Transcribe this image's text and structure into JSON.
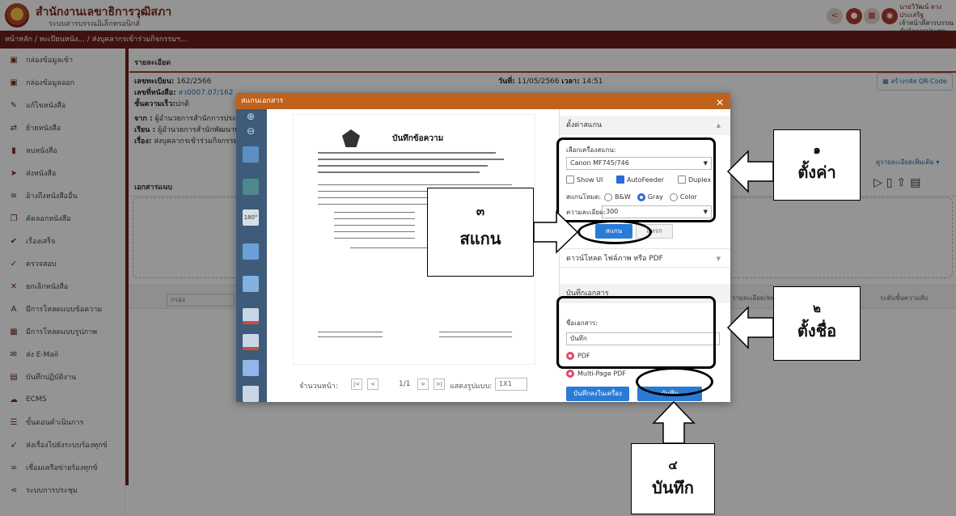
{
  "header": {
    "org_name": "สำนักงานเลขาธิการวุฒิสภา",
    "org_sub": "ระบบสารบรรณอิเล็กทรอนิกส์",
    "user_name": "นายวิวัฒน์ ดวงประเสริฐ",
    "user_role": "เจ้าหน้าที่สารบรรณ",
    "user_unit": "สำนักการประชุม"
  },
  "breadcrumb": "หน้าหลัก / ทะเบียนหนัง... / ส่งบุคลากรเข้าร่วมกิจกรรมฯ...",
  "sidebar": {
    "items": [
      {
        "label": "กล่องข้อมูลเข้า",
        "icon": "inbox-icon",
        "glyph": "▣"
      },
      {
        "label": "กล่องข้อมูลออก",
        "icon": "outbox-icon",
        "glyph": "▣"
      },
      {
        "label": "แก้ไขหนังสือ",
        "icon": "edit-icon",
        "glyph": "✎"
      },
      {
        "label": "ย้ายหนังสือ",
        "icon": "move-icon",
        "glyph": "⇄"
      },
      {
        "label": "ลบหนังสือ",
        "icon": "trash-icon",
        "glyph": "▮"
      },
      {
        "label": "ส่งหนังสือ",
        "icon": "send-icon",
        "glyph": "➤"
      },
      {
        "label": "อ้างถึงหนังสืออื่น",
        "icon": "reference-icon",
        "glyph": "≡"
      },
      {
        "label": "คัดลอกหนังสือ",
        "icon": "copy-icon",
        "glyph": "❐"
      },
      {
        "label": "เรื่องเสร็จ",
        "icon": "done-icon",
        "glyph": "✔"
      },
      {
        "label": "ตรวจสอบ",
        "icon": "check-icon",
        "glyph": "✓"
      },
      {
        "label": "ยกเลิกหนังสือ",
        "icon": "cancel-icon",
        "glyph": "✕"
      },
      {
        "label": "มีการโหลดแบบข้อความ",
        "icon": "text-icon",
        "glyph": "A"
      },
      {
        "label": "มีการโหลดแบบรูปภาพ",
        "icon": "image-icon",
        "glyph": "▦"
      },
      {
        "label": "ส่ง E-Mail",
        "icon": "mail-icon",
        "glyph": "✉"
      },
      {
        "label": "บันทึกปฏิบัติงาน",
        "icon": "log-icon",
        "glyph": "▤"
      },
      {
        "label": "ECMS",
        "icon": "cloud-icon",
        "glyph": "☁"
      },
      {
        "label": "ขั้นตอนดำเนินการ",
        "icon": "steps-icon",
        "glyph": "☰"
      },
      {
        "label": "ส่งเรื่องไปยังระบบร้องทุกข์",
        "icon": "forward-icon",
        "glyph": "➶"
      },
      {
        "label": "เชื่อมเครือข่ายร้องทุกข์",
        "icon": "link-icon",
        "glyph": "∞"
      },
      {
        "label": "ระบบการประชุม",
        "icon": "share-icon",
        "glyph": "⋖"
      }
    ]
  },
  "main": {
    "section_detail": "รายละเอียด",
    "reg_label": "เลขทะเบียน:",
    "reg_value": "162/2566",
    "doc_no_label": "เลขที่หนังสือ:",
    "doc_no_value": "สว0007.07/162",
    "priority_label": "ชั้นความเร็ว:",
    "priority_value": "ปกติ",
    "from_label": "จาก :",
    "from_value": "ผู้อำนวยการสำนักการประชุ",
    "to_label": "เรียน :",
    "to_value": "ผู้อำนวยการสำนักพัฒนาทรั",
    "subject_label": "เรื่อง:",
    "subject_value": "ส่งบุคลากรเข้าร่วมกิจกรรมฯ",
    "date_label": "วันที่:",
    "date_value": "11/05/2566",
    "time_label": "เวลา:",
    "time_value": "14:51",
    "qr_button": "สร้างรหัส QR-Code",
    "more_details": "ดูรายละเอียดเพิ่มเติม ▾",
    "attachments": "เอกสารแนบ",
    "col_detail": "รายละเอียด/หมายเหตุ",
    "col_secret": "ระดับชั้นความลับ",
    "filter_placeholder": "กรอง"
  },
  "modal": {
    "title": "สแกนเอกสาร",
    "close": "✕",
    "preview_doc_title": "บันทึกข้อความ",
    "pager_label": "จำนวนหน้า:",
    "page_first": "|<",
    "page_prev": "<",
    "page_num": "1/1",
    "page_next": ">",
    "page_last": ">|",
    "view_label": "แสดงรูปแบบ:",
    "view_value": "1X1",
    "settings_header": "ตั้งค่าสแกน",
    "scanner_label": "เลือกเครื่องสแกน:",
    "scanner_value": "Canon MF745/746",
    "show_ui": "Show UI",
    "auto_feeder": "AutoFeeder",
    "duplex": "Duplex",
    "mode_label": "สแกนโหมด:",
    "mode_bw": "B&W",
    "mode_gray": "Gray",
    "mode_color": "Color",
    "resolution_label": "ความละเอียด:",
    "resolution_value": "300",
    "scan_button": "สแกน",
    "insert_button": "แทรก",
    "download_header": "ดาวน์โหลด ไฟล์ภาพ หรือ PDF",
    "save_header": "บันทึกเอกสาร",
    "docname_label": "ชื่อเอกสาร:",
    "docname_value": "บันทึก",
    "pdf": "PDF",
    "multi_pdf": "Multi-Page PDF",
    "save_local": "บันทึกลงในเครื่อง",
    "save": "บันทึก"
  },
  "annotations": {
    "a1_num": "๑",
    "a1_word": "ตั้งค่า",
    "a2_num": "๒",
    "a2_word": "ตั้งชื่อ",
    "a3_num": "๓",
    "a3_word": "สแกน",
    "a4_num": "๔",
    "a4_word": "บันทึก"
  },
  "colors": {
    "brand_dark": "#6e1f1a",
    "modal_header": "#c0621c",
    "primary_button": "#2a7bd6"
  }
}
